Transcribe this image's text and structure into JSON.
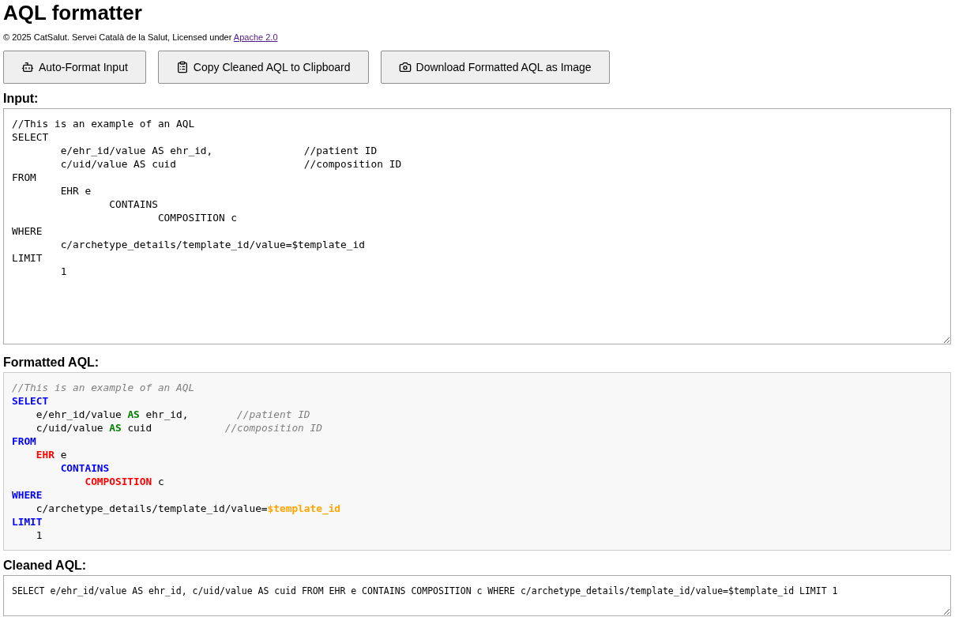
{
  "title": "AQL formatter",
  "footer_note": {
    "text": "© 2025 CatSalut. Servei Català de la Salut, Licensed under",
    "link": "Apache 2.0"
  },
  "buttons": [
    {
      "label": "Auto-Format Input"
    },
    {
      "label": "Copy Cleaned AQL to Clipboard"
    },
    {
      "label": "Download Formatted AQL as Image"
    }
  ],
  "input": {
    "label": "Input:",
    "value": "//This is an example of an AQL\nSELECT\n\te/ehr_id/value AS ehr_id,\t\t//patient ID\n\tc/uid/value AS cuid\t\t\t//composition ID\nFROM\n\tEHR e\n\t\tCONTAINS\n\t\t\tCOMPOSITION c\nWHERE\n\tc/archetype_details/template_id/value=$template_id\nLIMIT\n\t1"
  },
  "formatted": {
    "label": "Formatted AQL:",
    "lines": [
      {
        "tokens": [
          {
            "kind": "comment",
            "text": "//This is an example of an AQL"
          }
        ]
      },
      {
        "tokens": [
          {
            "kind": "keyword",
            "text": "SELECT"
          }
        ],
        "children": [
          {
            "tokens": [
              {
                "kind": "plain",
                "text": "e/ehr_id/value "
              },
              {
                "kind": "alias",
                "text": "AS"
              },
              {
                "kind": "plain",
                "text": " ehr_id,        "
              },
              {
                "kind": "comment",
                "text": "//patient ID"
              }
            ]
          },
          {
            "tokens": [
              {
                "kind": "plain",
                "text": "c/uid/value "
              },
              {
                "kind": "alias",
                "text": "AS"
              },
              {
                "kind": "plain",
                "text": " cuid            "
              },
              {
                "kind": "comment",
                "text": "//composition ID"
              }
            ]
          }
        ]
      },
      {
        "tokens": [
          {
            "kind": "keyword",
            "text": "FROM"
          }
        ],
        "children": [
          {
            "tokens": [
              {
                "kind": "entity",
                "text": "EHR"
              },
              {
                "kind": "plain",
                "text": " e"
              }
            ],
            "children": [
              {
                "tokens": [
                  {
                    "kind": "keyword",
                    "text": "CONTAINS"
                  }
                ],
                "children": [
                  {
                    "tokens": [
                      {
                        "kind": "entity",
                        "text": "COMPOSITION"
                      },
                      {
                        "kind": "plain",
                        "text": " c"
                      }
                    ]
                  }
                ]
              }
            ]
          }
        ]
      },
      {
        "tokens": [
          {
            "kind": "keyword",
            "text": "WHERE"
          }
        ],
        "children": [
          {
            "tokens": [
              {
                "kind": "plain",
                "text": "c/archetype_details/template_id/value="
              },
              {
                "kind": "parameter",
                "text": "$template_id"
              }
            ]
          }
        ]
      },
      {
        "tokens": [
          {
            "kind": "keyword",
            "text": "LIMIT"
          }
        ],
        "children": [
          {
            "tokens": [
              {
                "kind": "plain",
                "text": "1"
              }
            ]
          }
        ]
      }
    ]
  },
  "cleaned": {
    "label": "Cleaned AQL:",
    "value": "SELECT e/ehr_id/value AS ehr_id, c/uid/value AS cuid FROM EHR e CONTAINS COMPOSITION c WHERE c/archetype_details/template_id/value=$template_id LIMIT 1"
  }
}
